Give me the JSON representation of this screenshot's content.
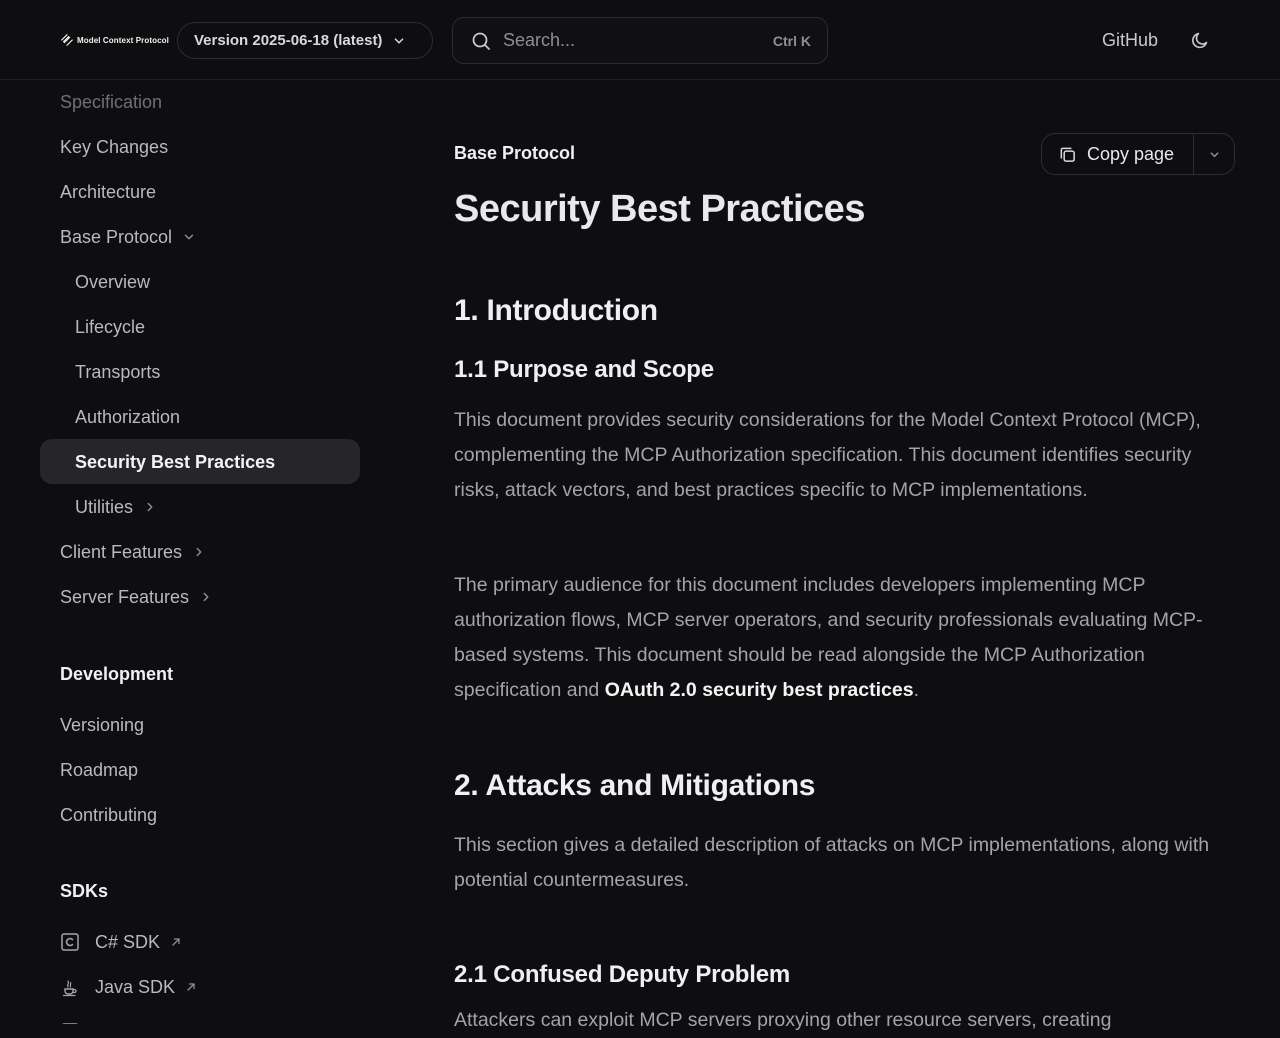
{
  "header": {
    "logo_text": "Model Context Protocol",
    "version_label": "Version 2025-06-18 (latest)",
    "search_placeholder": "Search...",
    "search_shortcut": "Ctrl K",
    "github_label": "GitHub"
  },
  "sidebar": {
    "items": [
      {
        "label": "Specification"
      },
      {
        "label": "Key Changes"
      },
      {
        "label": "Architecture"
      },
      {
        "label": "Base Protocol"
      },
      {
        "label": "Overview"
      },
      {
        "label": "Lifecycle"
      },
      {
        "label": "Transports"
      },
      {
        "label": "Authorization"
      },
      {
        "label": "Security Best Practices"
      },
      {
        "label": "Utilities"
      },
      {
        "label": "Client Features"
      },
      {
        "label": "Server Features"
      }
    ],
    "development": {
      "heading": "Development",
      "items": [
        "Versioning",
        "Roadmap",
        "Contributing"
      ]
    },
    "sdks": {
      "heading": "SDKs",
      "items": [
        "C# SDK",
        "Java SDK"
      ]
    }
  },
  "main": {
    "eyebrow": "Base Protocol",
    "copy_label": "Copy page",
    "title": "Security Best Practices",
    "sections": [
      {
        "heading": "1. Introduction"
      },
      {
        "heading": "1.1 Purpose and Scope"
      },
      {
        "heading": "2. Attacks and Mitigations"
      },
      {
        "heading": "2.1 Confused Deputy Problem"
      }
    ],
    "paragraphs": {
      "p1": "This document provides security considerations for the Model Context Protocol (MCP), complementing the MCP Authorization specification. This document identifies security risks, attack vectors, and best practices specific to MCP implementations.",
      "p2_before": "The primary audience for this document includes developers implementing MCP authorization flows, MCP server operators, and security professionals evaluating MCP-based systems. This document should be read alongside the MCP Authorization specification and ",
      "p2_link": "OAuth 2.0 security best practices",
      "p2_after": ".",
      "p3": "This section gives a detailed description of attacks on MCP implementations, along with potential countermeasures.",
      "p4": "Attackers can exploit MCP servers proxying other resource servers, creating"
    }
  }
}
